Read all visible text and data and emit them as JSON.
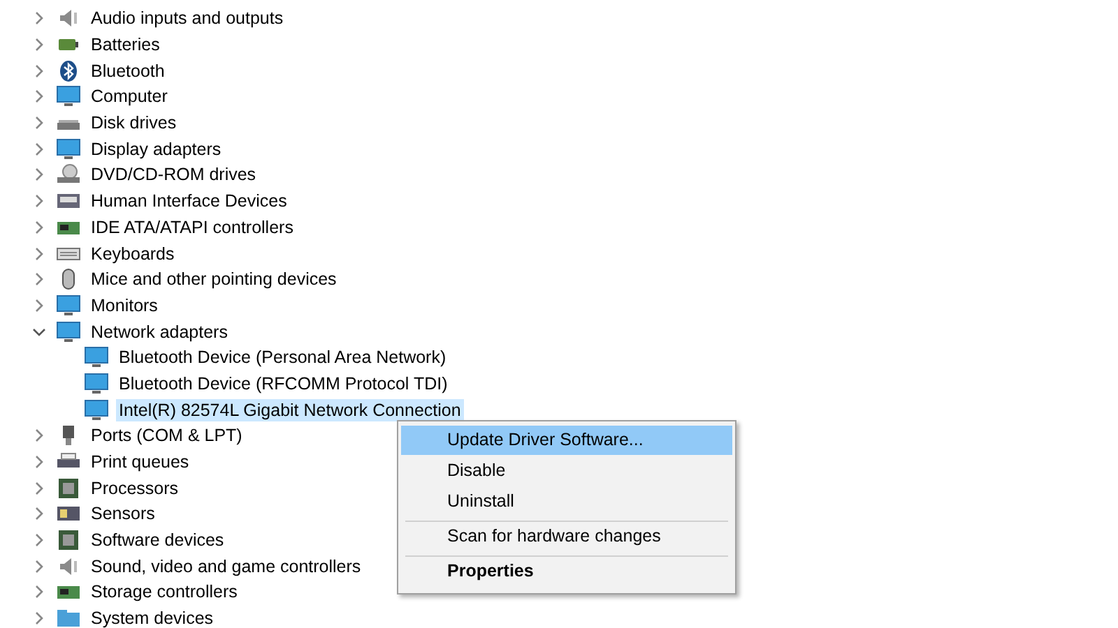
{
  "tree": [
    {
      "label": "Audio inputs and outputs",
      "expanded": false
    },
    {
      "label": "Batteries",
      "expanded": false
    },
    {
      "label": "Bluetooth",
      "expanded": false
    },
    {
      "label": "Computer",
      "expanded": false
    },
    {
      "label": "Disk drives",
      "expanded": false
    },
    {
      "label": "Display adapters",
      "expanded": false
    },
    {
      "label": "DVD/CD-ROM drives",
      "expanded": false
    },
    {
      "label": "Human Interface Devices",
      "expanded": false
    },
    {
      "label": "IDE ATA/ATAPI controllers",
      "expanded": false
    },
    {
      "label": "Keyboards",
      "expanded": false
    },
    {
      "label": "Mice and other pointing devices",
      "expanded": false
    },
    {
      "label": "Monitors",
      "expanded": false
    },
    {
      "label": "Network adapters",
      "expanded": true,
      "children": [
        {
          "label": "Bluetooth Device (Personal Area Network)",
          "selected": false
        },
        {
          "label": "Bluetooth Device (RFCOMM Protocol TDI)",
          "selected": false
        },
        {
          "label": "Intel(R) 82574L Gigabit Network Connection",
          "selected": true
        }
      ]
    },
    {
      "label": "Ports (COM & LPT)",
      "expanded": false
    },
    {
      "label": "Print queues",
      "expanded": false
    },
    {
      "label": "Processors",
      "expanded": false
    },
    {
      "label": "Sensors",
      "expanded": false
    },
    {
      "label": "Software devices",
      "expanded": false
    },
    {
      "label": "Sound, video and game controllers",
      "expanded": false
    },
    {
      "label": "Storage controllers",
      "expanded": false
    },
    {
      "label": "System devices",
      "expanded": false
    }
  ],
  "context_menu": [
    {
      "label": "Update Driver Software...",
      "selected": true,
      "bold": false,
      "separator_before": false
    },
    {
      "label": "Disable",
      "selected": false,
      "bold": false,
      "separator_before": false
    },
    {
      "label": "Uninstall",
      "selected": false,
      "bold": false,
      "separator_before": false
    },
    {
      "label": "Scan for hardware changes",
      "selected": false,
      "bold": false,
      "separator_before": true
    },
    {
      "label": "Properties",
      "selected": false,
      "bold": true,
      "separator_before": true
    }
  ]
}
